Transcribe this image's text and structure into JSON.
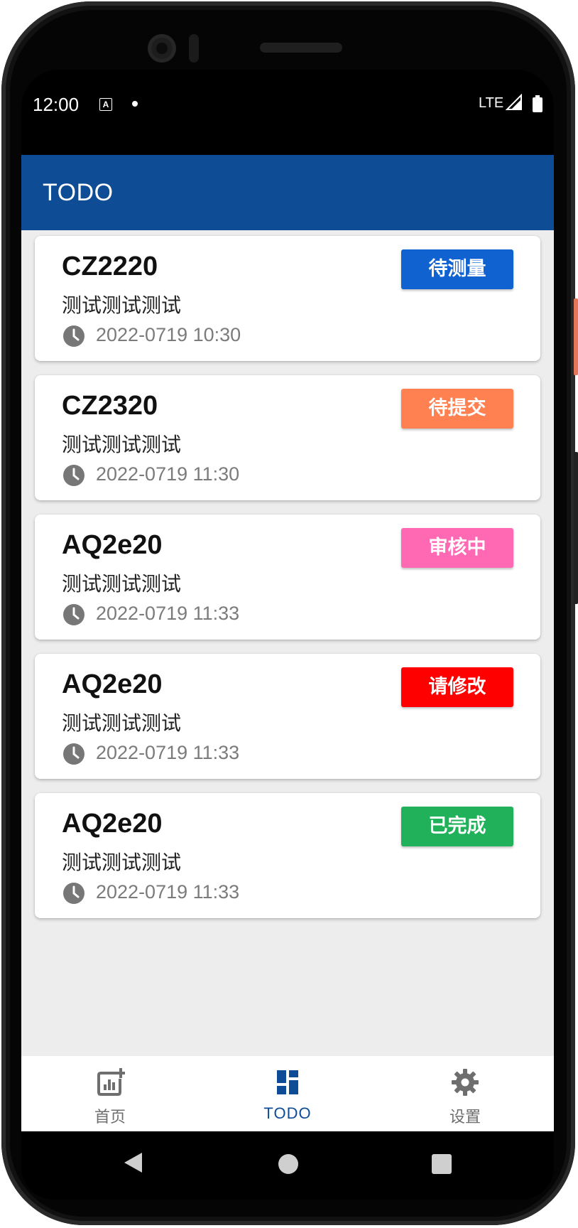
{
  "status_bar": {
    "time": "12:00",
    "network": "LTE"
  },
  "app_bar": {
    "title": "TODO"
  },
  "todos": [
    {
      "code": "CZ2220",
      "desc": "测试测试测试",
      "time": "2022-0719 10:30",
      "status": "待测量",
      "status_color": "#0f62d0"
    },
    {
      "code": "CZ2320",
      "desc": "测试测试测试",
      "time": "2022-0719 11:30",
      "status": "待提交",
      "status_color": "#ff8050"
    },
    {
      "code": "AQ2e20",
      "desc": "测试测试测试",
      "time": "2022-0719 11:33",
      "status": "审核中",
      "status_color": "#ff69b4"
    },
    {
      "code": "AQ2e20",
      "desc": "测试测试测试",
      "time": "2022-0719 11:33",
      "status": "请修改",
      "status_color": "#ff0000"
    },
    {
      "code": "AQ2e20",
      "desc": "测试测试测试",
      "time": "2022-0719 11:33",
      "status": "已完成",
      "status_color": "#20b15a"
    }
  ],
  "bottom_nav": {
    "items": [
      {
        "label": "首页",
        "icon": "chart-add-icon"
      },
      {
        "label": "TODO",
        "icon": "dashboard-icon",
        "active": true
      },
      {
        "label": "设置",
        "icon": "gear-icon"
      }
    ]
  },
  "colors": {
    "primary": "#0f4c96",
    "background": "#ededed",
    "inactive": "#6e6e6e"
  }
}
